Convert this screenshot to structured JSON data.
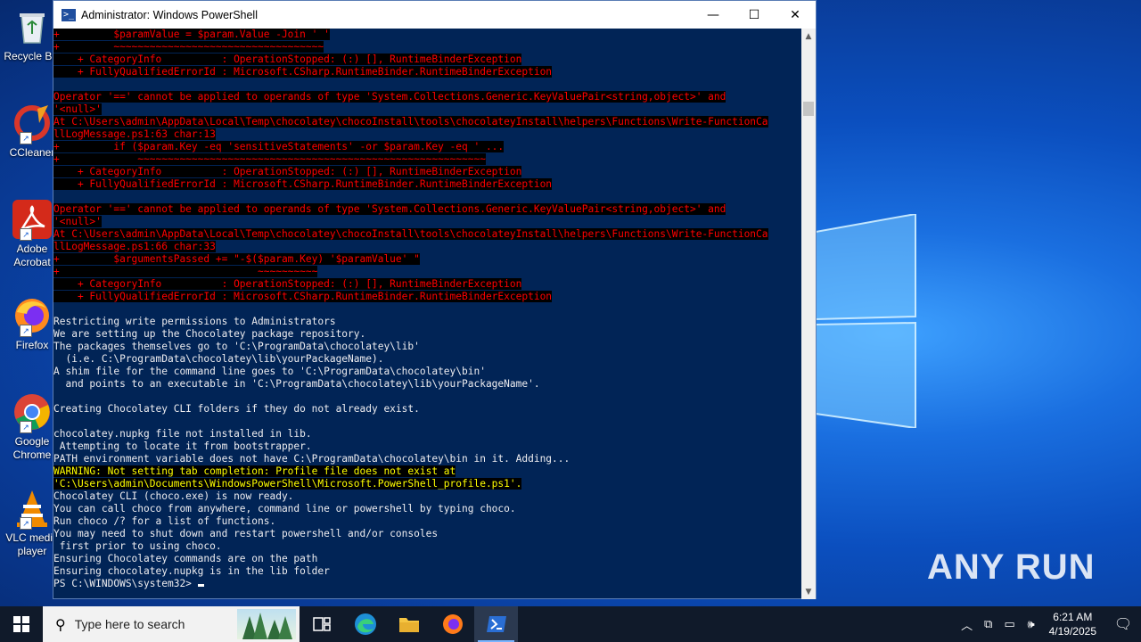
{
  "window": {
    "title": "Administrator: Windows PowerShell",
    "minimize_glyph": "—",
    "maximize_glyph": "☐",
    "close_glyph": "✕"
  },
  "console_lines": [
    {
      "t": "+         $paramValue = $param.Value -Join ' '",
      "c": "err"
    },
    {
      "t": "+         ~~~~~~~~~~~~~~~~~~~~~~~~~~~~~~~~~~~",
      "c": "err"
    },
    {
      "t": "    + CategoryInfo          : OperationStopped: (:) [], RuntimeBinderException",
      "c": "err"
    },
    {
      "t": "    + FullyQualifiedErrorId : Microsoft.CSharp.RuntimeBinder.RuntimeBinderException",
      "c": "err"
    },
    {
      "t": "",
      "c": "err"
    },
    {
      "t": "Operator '==' cannot be applied to operands of type 'System.Collections.Generic.KeyValuePair<string,object>' and",
      "c": "err"
    },
    {
      "t": "'<null>'",
      "c": "err"
    },
    {
      "t": "At C:\\Users\\admin\\AppData\\Local\\Temp\\chocolatey\\chocoInstall\\tools\\chocolateyInstall\\helpers\\Functions\\Write-FunctionCa",
      "c": "err"
    },
    {
      "t": "llLogMessage.ps1:63 char:13",
      "c": "err"
    },
    {
      "t": "+         if ($param.Key -eq 'sensitiveStatements' -or $param.Key -eq ' ...",
      "c": "err"
    },
    {
      "t": "+             ~~~~~~~~~~~~~~~~~~~~~~~~~~~~~~~~~~~~~~~~~~~~~~~~~~~~~~~~~~",
      "c": "err"
    },
    {
      "t": "    + CategoryInfo          : OperationStopped: (:) [], RuntimeBinderException",
      "c": "err"
    },
    {
      "t": "    + FullyQualifiedErrorId : Microsoft.CSharp.RuntimeBinder.RuntimeBinderException",
      "c": "err"
    },
    {
      "t": "",
      "c": "err"
    },
    {
      "t": "Operator '==' cannot be applied to operands of type 'System.Collections.Generic.KeyValuePair<string,object>' and",
      "c": "err"
    },
    {
      "t": "'<null>'",
      "c": "err"
    },
    {
      "t": "At C:\\Users\\admin\\AppData\\Local\\Temp\\chocolatey\\chocoInstall\\tools\\chocolateyInstall\\helpers\\Functions\\Write-FunctionCa",
      "c": "err"
    },
    {
      "t": "llLogMessage.ps1:66 char:33",
      "c": "err"
    },
    {
      "t": "+         $argumentsPassed += \"-$($param.Key) '$paramValue' \"",
      "c": "err"
    },
    {
      "t": "+                                 ~~~~~~~~~~",
      "c": "err"
    },
    {
      "t": "    + CategoryInfo          : OperationStopped: (:) [], RuntimeBinderException",
      "c": "err"
    },
    {
      "t": "    + FullyQualifiedErrorId : Microsoft.CSharp.RuntimeBinder.RuntimeBinderException",
      "c": "err"
    },
    {
      "t": "",
      "c": "err"
    },
    {
      "t": "Restricting write permissions to Administrators",
      "c": "out"
    },
    {
      "t": "We are setting up the Chocolatey package repository.",
      "c": "out"
    },
    {
      "t": "The packages themselves go to 'C:\\ProgramData\\chocolatey\\lib'",
      "c": "out"
    },
    {
      "t": "  (i.e. C:\\ProgramData\\chocolatey\\lib\\yourPackageName).",
      "c": "out"
    },
    {
      "t": "A shim file for the command line goes to 'C:\\ProgramData\\chocolatey\\bin'",
      "c": "out"
    },
    {
      "t": "  and points to an executable in 'C:\\ProgramData\\chocolatey\\lib\\yourPackageName'.",
      "c": "out"
    },
    {
      "t": "",
      "c": "out"
    },
    {
      "t": "Creating Chocolatey CLI folders if they do not already exist.",
      "c": "out"
    },
    {
      "t": "",
      "c": "out"
    },
    {
      "t": "chocolatey.nupkg file not installed in lib.",
      "c": "out"
    },
    {
      "t": " Attempting to locate it from bootstrapper.",
      "c": "out"
    },
    {
      "t": "PATH environment variable does not have C:\\ProgramData\\chocolatey\\bin in it. Adding...",
      "c": "out"
    },
    {
      "t": "WARNING: Not setting tab completion: Profile file does not exist at",
      "c": "warn"
    },
    {
      "t": "'C:\\Users\\admin\\Documents\\WindowsPowerShell\\Microsoft.PowerShell_profile.ps1'.",
      "c": "warn"
    },
    {
      "t": "Chocolatey CLI (choco.exe) is now ready.",
      "c": "out"
    },
    {
      "t": "You can call choco from anywhere, command line or powershell by typing choco.",
      "c": "out"
    },
    {
      "t": "Run choco /? for a list of functions.",
      "c": "out"
    },
    {
      "t": "You may need to shut down and restart powershell and/or consoles",
      "c": "out"
    },
    {
      "t": " first prior to using choco.",
      "c": "out"
    },
    {
      "t": "Ensuring Chocolatey commands are on the path",
      "c": "out"
    },
    {
      "t": "Ensuring chocolatey.nupkg is in the lib folder",
      "c": "out"
    },
    {
      "t": "PS C:\\WINDOWS\\system32> ",
      "c": "prompt"
    }
  ],
  "desktop_icons": [
    {
      "name": "recycle-bin",
      "label": "Recycle Bin",
      "icon": "recycle-bin-icon"
    },
    {
      "name": "ccleaner",
      "label": "CCleaner",
      "icon": "ccleaner-icon"
    },
    {
      "name": "adobe-acrobat",
      "label": "Adobe Acrobat",
      "icon": "adobe-acrobat-icon"
    },
    {
      "name": "firefox",
      "label": "Firefox",
      "icon": "firefox-icon"
    },
    {
      "name": "google-chrome",
      "label": "Google Chrome",
      "icon": "chrome-icon"
    },
    {
      "name": "vlc",
      "label": "VLC media player",
      "icon": "vlc-icon"
    }
  ],
  "watermark": "ANY RUN",
  "taskbar": {
    "search_placeholder": "Type here to search",
    "apps": [
      "task-view-icon",
      "edge-icon",
      "file-explorer-icon",
      "firefox-icon",
      "powershell-icon"
    ],
    "active_app": "powershell-icon",
    "time": "6:21 AM",
    "date": "4/19/2025"
  },
  "colors": {
    "console_bg": "#012456",
    "console_text": "#eeedf0",
    "error_text": "#ff0000",
    "warning_text": "#ffff00",
    "highlight_bg": "#000000",
    "taskbar_bg": "#101a2a"
  }
}
